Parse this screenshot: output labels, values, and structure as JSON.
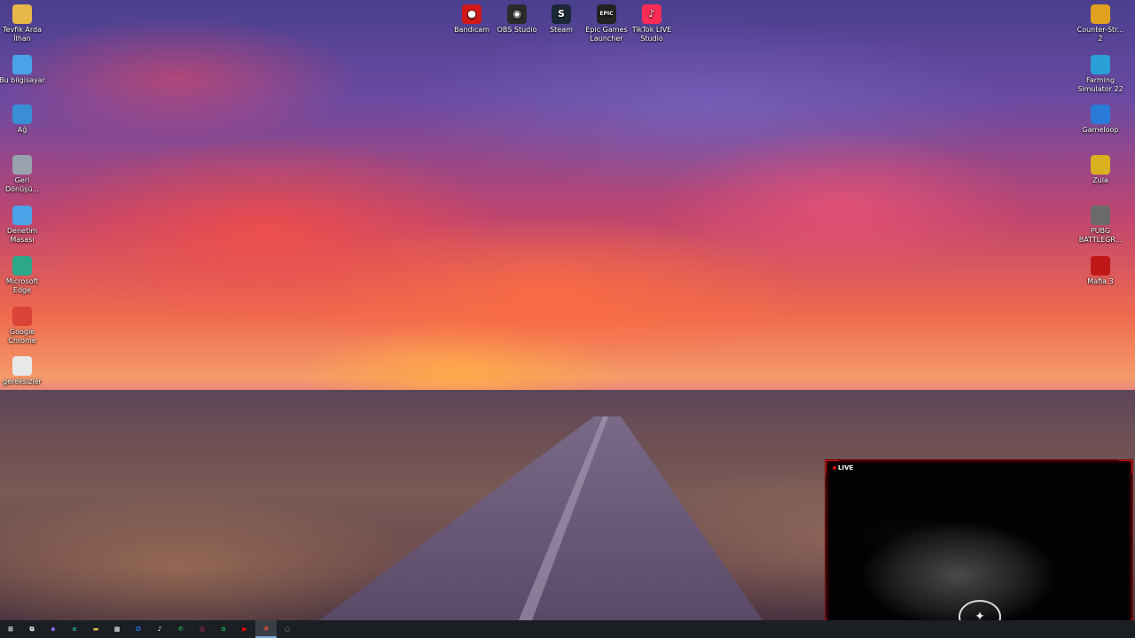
{
  "desktop": {
    "left_icons": [
      {
        "label": "Tevfik Arda İlhan",
        "icon": "folder-user-icon",
        "color": "#e6b84a"
      },
      {
        "label": "Bu bilgisayar",
        "icon": "computer-icon",
        "color": "#4aa3e6"
      },
      {
        "label": "Ağ",
        "icon": "network-icon",
        "color": "#3a8ed6"
      },
      {
        "label": "Geri Dönüşü...",
        "icon": "recycle-bin-icon",
        "color": "#9aa3ad"
      },
      {
        "label": "Denetim Masası",
        "icon": "control-panel-icon",
        "color": "#4aa3e6"
      },
      {
        "label": "Microsoft Edge",
        "icon": "edge-icon",
        "color": "#2aa889"
      },
      {
        "label": "Google Chrome",
        "icon": "chrome-icon",
        "color": "#db4437"
      },
      {
        "label": "gereksizler",
        "icon": "file-icon",
        "color": "#e8e8e8"
      }
    ],
    "top_icons": [
      {
        "label": "Bandicam",
        "icon": "bandicam-icon",
        "color": "#d01818",
        "glyph": "●"
      },
      {
        "label": "OBS Studio",
        "icon": "obs-icon",
        "color": "#2b2b2b",
        "glyph": "◉"
      },
      {
        "label": "Steam",
        "icon": "steam-icon",
        "color": "#1b2838",
        "glyph": "S"
      },
      {
        "label": "Epic Games Launcher",
        "icon": "epic-games-icon",
        "color": "#222222",
        "glyph": "EPIC"
      },
      {
        "label": "TikTok LIVE Studio",
        "icon": "tiktok-live-icon",
        "color": "#fe2c55",
        "glyph": "♪"
      }
    ],
    "right_icons": [
      {
        "label": "Counter-Str... 2",
        "icon": "counter-strike-icon",
        "color": "#e0a020"
      },
      {
        "label": "Farming Simulator 22",
        "icon": "farming-simulator-icon",
        "color": "#2aa0d8"
      },
      {
        "label": "Gameloop",
        "icon": "gameloop-icon",
        "color": "#2a7ad8"
      },
      {
        "label": "Zula",
        "icon": "zula-icon",
        "color": "#d8b020"
      },
      {
        "label": "PUBG BATTLEGR...",
        "icon": "pubg-icon",
        "color": "#6a6a6a"
      },
      {
        "label": "Mafia 3",
        "icon": "mafia-icon",
        "color": "#c01818"
      }
    ]
  },
  "webcam": {
    "live_label": "LIVE"
  },
  "taskbar": {
    "items": [
      {
        "name": "start-button",
        "glyph": "⊞",
        "color": "#ffffff"
      },
      {
        "name": "task-view-button",
        "glyph": "⧉",
        "color": "#ffffff"
      },
      {
        "name": "copilot-icon",
        "glyph": "◆",
        "color": "#8a6ae0"
      },
      {
        "name": "edge-icon",
        "glyph": "e",
        "color": "#2aa889"
      },
      {
        "name": "file-explorer-icon",
        "glyph": "▬",
        "color": "#e6b84a"
      },
      {
        "name": "store-icon",
        "glyph": "▦",
        "color": "#ffffff"
      },
      {
        "name": "outlook-icon",
        "glyph": "O",
        "color": "#1a73d8"
      },
      {
        "name": "tiktok-icon",
        "glyph": "♪",
        "color": "#ffffff"
      },
      {
        "name": "whatsapp-icon",
        "glyph": "✆",
        "color": "#25d366"
      },
      {
        "name": "instagram-icon",
        "glyph": "◎",
        "color": "#e1306c"
      },
      {
        "name": "spotify-icon",
        "glyph": "≋",
        "color": "#1db954"
      },
      {
        "name": "youtube-icon",
        "glyph": "▶",
        "color": "#ff0000"
      },
      {
        "name": "chrome-icon",
        "glyph": "◉",
        "color": "#db4437",
        "active": true
      },
      {
        "name": "obs-icon",
        "glyph": "◌",
        "color": "#cccccc"
      }
    ]
  }
}
